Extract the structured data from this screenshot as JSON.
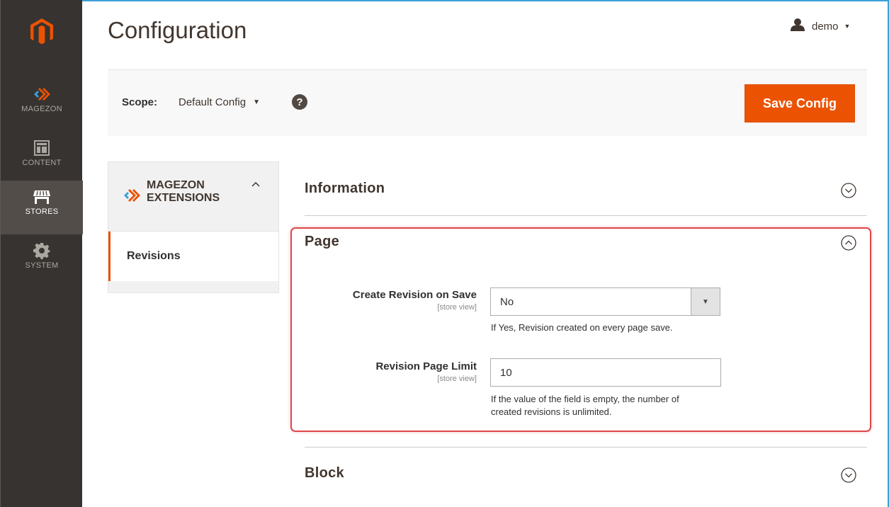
{
  "sidebar": {
    "logo": "magento-logo",
    "items": [
      {
        "label": "MAGEZON",
        "icon": "magezon-icon",
        "active": false
      },
      {
        "label": "CONTENT",
        "icon": "content-icon",
        "active": false
      },
      {
        "label": "STORES",
        "icon": "stores-icon",
        "active": true
      },
      {
        "label": "SYSTEM",
        "icon": "gear-icon",
        "active": false
      }
    ]
  },
  "header": {
    "title": "Configuration",
    "user": {
      "name": "demo",
      "icon": "user-icon"
    }
  },
  "scope": {
    "label": "Scope:",
    "value": "Default Config",
    "help_icon": "?",
    "save_label": "Save Config"
  },
  "tabs": {
    "group_title_line1": "MAGEZON",
    "group_title_line2": "EXTENSIONS",
    "items": [
      {
        "label": "Revisions",
        "active": true
      }
    ]
  },
  "sections": {
    "information": {
      "title": "Information",
      "expanded": false
    },
    "page": {
      "title": "Page",
      "expanded": true,
      "fields": [
        {
          "label": "Create Revision on Save",
          "scope": "[store view]",
          "value": "No",
          "note": "If Yes, Revision created on every page save."
        },
        {
          "label": "Revision Page Limit",
          "scope": "[store view]",
          "value": "10",
          "note_line1": "If the value of the field is empty, the number of",
          "note_line2": "created revisions is unlimited."
        }
      ]
    },
    "block": {
      "title": "Block",
      "expanded": false
    }
  },
  "colors": {
    "accent": "#eb5202",
    "sidebar_bg": "#373330",
    "highlight": "#e0474a"
  }
}
